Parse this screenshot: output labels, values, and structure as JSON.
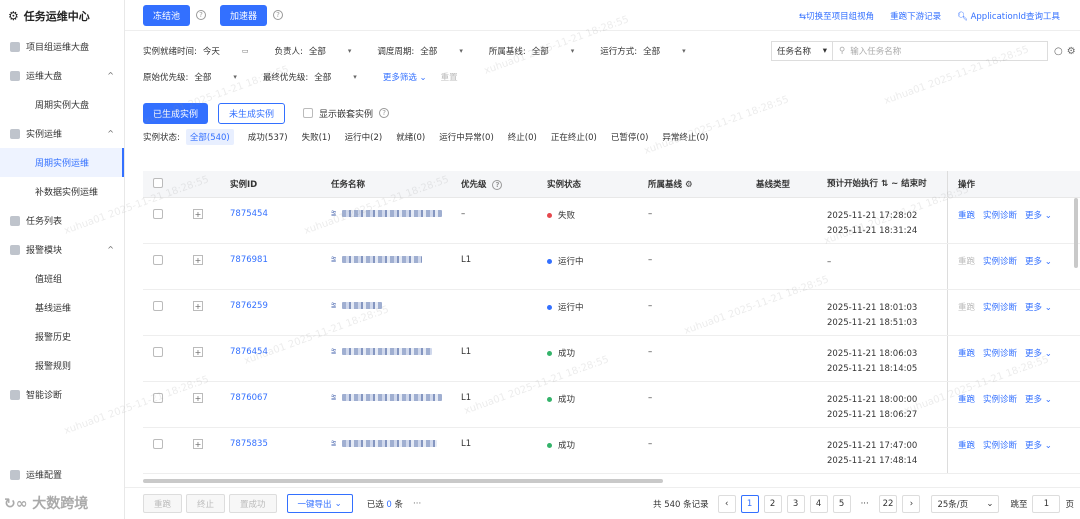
{
  "app": {
    "title": "任务运维中心"
  },
  "sidebar": {
    "items": [
      {
        "label": "项目组运维大盘",
        "type": "top"
      },
      {
        "label": "运维大盘",
        "type": "group",
        "chevron": "^"
      },
      {
        "label": "周期实例大盘",
        "type": "sub"
      },
      {
        "label": "实例运维",
        "type": "group",
        "chevron": "^"
      },
      {
        "label": "周期实例运维",
        "type": "sub",
        "active": true
      },
      {
        "label": "补数据实例运维",
        "type": "sub"
      },
      {
        "label": "任务列表",
        "type": "top"
      },
      {
        "label": "报警模块",
        "type": "group",
        "chevron": "^"
      },
      {
        "label": "值班组",
        "type": "sub"
      },
      {
        "label": "基线运维",
        "type": "sub"
      },
      {
        "label": "报警历史",
        "type": "sub"
      },
      {
        "label": "报警规则",
        "type": "sub"
      },
      {
        "label": "智能诊断",
        "type": "top"
      }
    ],
    "bottom_item": "运维配置",
    "footer_brand": "大数跨境"
  },
  "toolbar": {
    "freeze_pool": "冻结池",
    "accelerator": "加速器",
    "links": [
      "⇆切换至项目组视角",
      "重跑下游记录",
      "ApplicationId查询工具"
    ]
  },
  "filters": {
    "row1": [
      {
        "label": "实例就绪时间:",
        "value": "今天"
      },
      {
        "label": "负责人:",
        "value": "全部"
      },
      {
        "label": "调度周期:",
        "value": "全部"
      },
      {
        "label": "所属基线:",
        "value": "全部"
      },
      {
        "label": "运行方式:",
        "value": "全部"
      }
    ],
    "row2": [
      {
        "label": "原始优先级:",
        "value": "全部"
      },
      {
        "label": "最终优先级:",
        "value": "全部"
      }
    ],
    "more_filter": "更多筛选",
    "reset": "重置",
    "search_select": "任务名称",
    "search_placeholder": "输入任务名称"
  },
  "tabs": {
    "generated": "已生成实例",
    "not_generated": "未生成实例",
    "show_nested": "显示嵌套实例"
  },
  "status": {
    "label": "实例状态:",
    "items": [
      "全部(540)",
      "成功(537)",
      "失败(1)",
      "运行中(2)",
      "就绪(0)",
      "运行中异常(0)",
      "终止(0)",
      "正在终止(0)",
      "已暂停(0)",
      "异常终止(0)"
    ]
  },
  "table": {
    "headers": {
      "id": "实例ID",
      "name": "任务名称",
      "priority": "优先级",
      "state": "实例状态",
      "baseline": "所属基线",
      "baseline_type": "基线类型",
      "planned": "预计开始执行",
      "end": "~ 结束时",
      "ops": "操作"
    },
    "rows": [
      {
        "id": "7875454",
        "name_w": 100,
        "priority": "–",
        "state": "失败",
        "state_color": "#e5484d",
        "baseline": "–",
        "t1": "2025-11-21 17:28:02",
        "t2": "2025-11-21 18:31:24",
        "rerun_enabled": true
      },
      {
        "id": "7876981",
        "name_w": 80,
        "priority": "L1",
        "state": "运行中",
        "state_color": "#3370ff",
        "baseline": "–",
        "t1": "–",
        "t2": "",
        "rerun_enabled": false
      },
      {
        "id": "7876259",
        "name_w": 40,
        "priority": "",
        "state": "运行中",
        "state_color": "#3370ff",
        "baseline": "–",
        "t1": "2025-11-21 18:01:03",
        "t2": "2025-11-21 18:51:03",
        "rerun_enabled": false
      },
      {
        "id": "7876454",
        "name_w": 90,
        "priority": "L1",
        "state": "成功",
        "state_color": "#34b36a",
        "baseline": "–",
        "t1": "2025-11-21 18:06:03",
        "t2": "2025-11-21 18:14:05",
        "rerun_enabled": true
      },
      {
        "id": "7876067",
        "name_w": 100,
        "priority": "L1",
        "state": "成功",
        "state_color": "#34b36a",
        "baseline": "–",
        "t1": "2025-11-21 18:00:00",
        "t2": "2025-11-21 18:06:27",
        "rerun_enabled": true
      },
      {
        "id": "7875835",
        "name_w": 95,
        "priority": "L1",
        "state": "成功",
        "state_color": "#34b36a",
        "baseline": "–",
        "t1": "2025-11-21 17:47:00",
        "t2": "2025-11-21 17:48:14",
        "rerun_enabled": true
      }
    ],
    "ops": {
      "rerun": "重跑",
      "diagnose": "实例诊断",
      "more": "更多"
    }
  },
  "footer": {
    "btn_rerun": "重跑",
    "btn_stop": "终止",
    "btn_set_success": "置成功",
    "btn_export": "一键导出",
    "selected_prefix": "已选",
    "selected_count": "0",
    "selected_suffix": "条",
    "total": "共 540 条记录",
    "pages": [
      "1",
      "2",
      "3",
      "4",
      "5",
      "···",
      "22"
    ],
    "current_page": "1",
    "page_size": "25条/页",
    "jump_label": "跳至",
    "jump_value": "1",
    "page_unit": "页"
  },
  "watermark_text": "xuhua01 2025-11-21 18:28:55"
}
